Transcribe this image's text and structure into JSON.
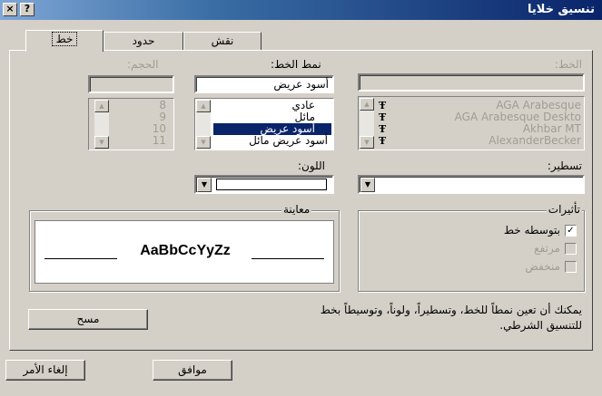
{
  "window": {
    "title": "تنسيق خلايا",
    "help_glyph": "?",
    "close_glyph": "×"
  },
  "tabs": [
    {
      "label": "خط"
    },
    {
      "label": "حدود"
    },
    {
      "label": "نقش"
    }
  ],
  "font": {
    "font_label": "الخط:",
    "font_value": "",
    "font_list": [
      "AGA Arabesque",
      "AGA Arabesque Deskto",
      "Akhbar MT",
      "AlexanderBecker"
    ],
    "style_label": "نمط الخط:",
    "style_value": "أسود عريض",
    "style_list": [
      "عادي",
      "مائل",
      "أسود عريض",
      "أسود عريض مائل"
    ],
    "size_label": "الحجم:",
    "size_value": "",
    "size_list": [
      "8",
      "9",
      "10",
      "11"
    ],
    "underline_label": "تسطير:",
    "underline_value": "",
    "color_label": "اللون:",
    "effects_label": "تأثيرات",
    "strikethrough_label": "بتوسطه خط",
    "strikethrough_checked": true,
    "superscript_label": "مرتفع",
    "subscript_label": "منخفض",
    "preview_label": "معاينة",
    "preview_text": "AaBbCcYyZz",
    "info_text_1": "يمكنك أن تعين نمطاً للخط، وتسطيراً، ولوناً، وتوسيطاً بخط",
    "info_text_2": "للتنسيق الشرطي.",
    "clear_button": "مسح"
  },
  "footer": {
    "ok_button": "موافق",
    "cancel_button": "إلغاء الأمر"
  },
  "icons": {
    "font_type": "truetype-font-icon",
    "scroll_up": "scroll-up-arrow-icon",
    "scroll_down": "scroll-down-arrow-icon",
    "dropdown": "dropdown-arrow-icon"
  }
}
